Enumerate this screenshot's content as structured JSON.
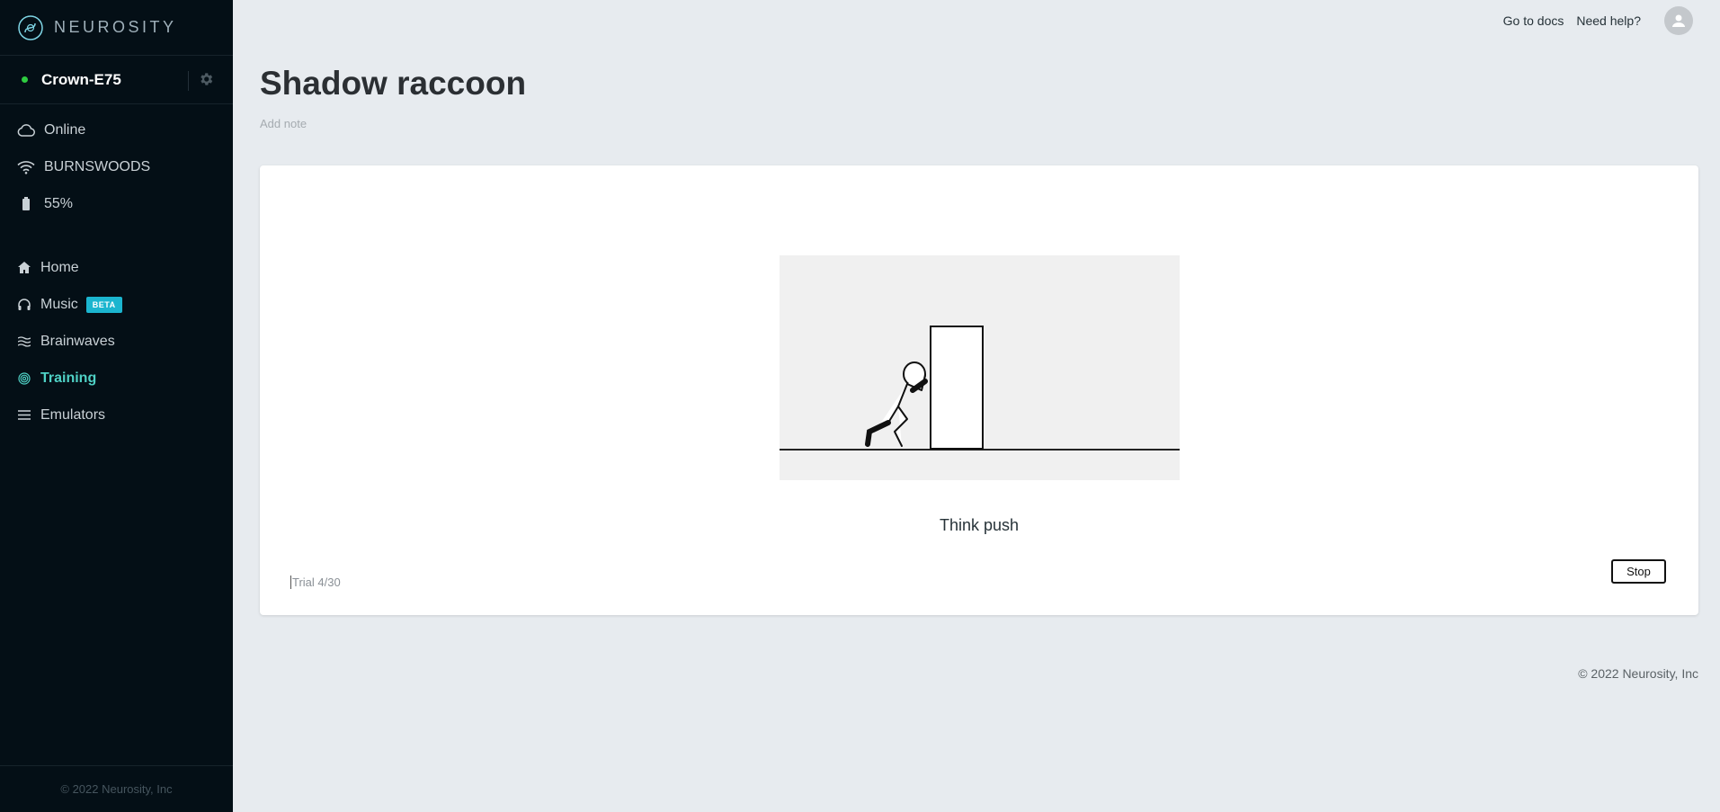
{
  "brand": {
    "name": "NEUROSITY",
    "logo_icon": "neurosity-logo-icon"
  },
  "device": {
    "name": "Crown-E75",
    "status_color": "#2ecc40"
  },
  "status": [
    {
      "icon": "cloud-icon",
      "label": "Online"
    },
    {
      "icon": "wifi-icon",
      "label": "BURNSWOODS"
    },
    {
      "icon": "battery-icon",
      "label": "55%"
    }
  ],
  "nav": [
    {
      "icon": "home-icon",
      "label": "Home"
    },
    {
      "icon": "headphones-icon",
      "label": "Music",
      "badge": "BETA"
    },
    {
      "icon": "brainwaves-icon",
      "label": "Brainwaves"
    },
    {
      "icon": "fingerprint-icon",
      "label": "Training",
      "active": true
    },
    {
      "icon": "menu-icon",
      "label": "Emulators"
    }
  ],
  "sidebar_footer": "© 2022 Neurosity, Inc",
  "header": {
    "docs_link": "Go to docs",
    "help_link": "Need help?"
  },
  "page": {
    "title": "Shadow raccoon",
    "note_placeholder": "Add note"
  },
  "training": {
    "prompt": "Think push",
    "trial": "Trial 4/30",
    "stop_label": "Stop"
  },
  "footer": "© 2022 Neurosity, Inc",
  "colors": {
    "sidebar_bg": "#040f16",
    "accent": "#4fd1c5",
    "beta_badge": "#1bb5cf",
    "page_bg": "#e7ebef"
  }
}
